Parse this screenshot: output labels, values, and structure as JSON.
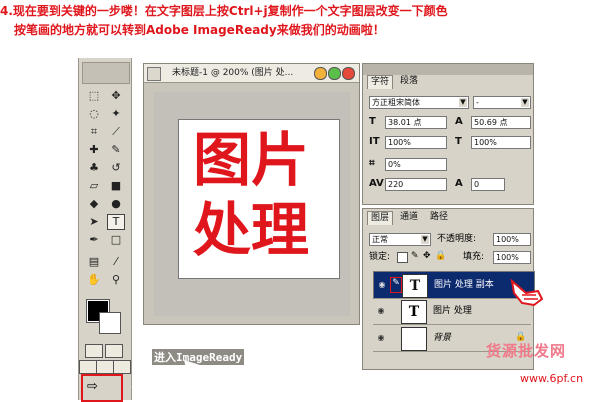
{
  "instruction": {
    "line1": "4.现在要到关键的一步喽！在文字图层上按Ctrl+j复制作一个文字图层改变一下颜色",
    "line2": "按笔画的地方就可以转到Adobe ImageReady来做我们的动画啦！"
  },
  "document": {
    "title": "未标题-1 @ 200% (图片 处...",
    "canvas_text_line1": "图片",
    "canvas_text_line2": "处理"
  },
  "character_panel": {
    "tabs": [
      "字符",
      "段落"
    ],
    "font_family": "方正粗宋简体",
    "font_style": "-",
    "font_size": "38.01 点",
    "leading": "50.69 点",
    "vertical_scale": "100%",
    "horizontal_scale": "100%",
    "kerning": "0%",
    "tracking": "220",
    "baseline": "0"
  },
  "layers_panel": {
    "tabs": [
      "图层",
      "通道",
      "路径"
    ],
    "blend_mode": "正常",
    "opacity_label": "不透明度:",
    "opacity": "100%",
    "lock_label": "锁定:",
    "fill_label": "填充:",
    "fill": "100%",
    "layers": [
      {
        "name": "图片 处理 副本",
        "thumb": "T"
      },
      {
        "name": "图片 处理",
        "thumb": "T"
      },
      {
        "name": "背景",
        "thumb": ""
      }
    ]
  },
  "annotation": {
    "label": "进入ImageReady"
  },
  "watermark": {
    "brand": "货源批发网",
    "site": "www.6pf.cn"
  }
}
